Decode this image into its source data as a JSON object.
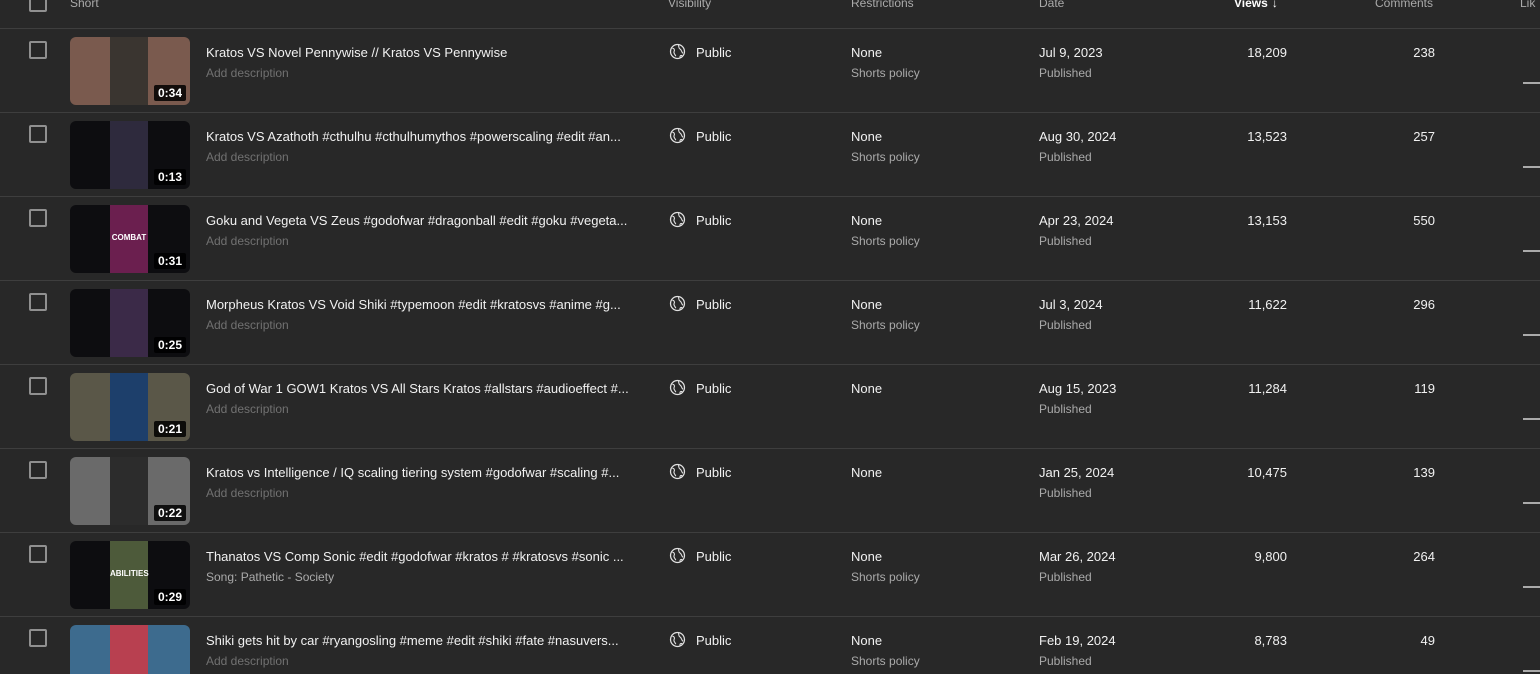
{
  "header": {
    "short": "Short",
    "visibility": "Visibility",
    "restrictions": "Restrictions",
    "date": "Date",
    "views": "Views",
    "views_sort_arrow": "↓",
    "comments": "Comments",
    "likes": "Lik"
  },
  "rows": [
    {
      "title": "Kratos VS Novel Pennywise // Kratos VS Pennywise",
      "description": "Add description",
      "duration": "0:34",
      "visibility": "Public",
      "restriction": "None",
      "restriction_detail": "Shorts policy",
      "date": "Jul 9, 2023",
      "status": "Published",
      "views": "18,209",
      "comments": "238",
      "thumb_bg": "#7a5a4e",
      "thumb_art": "#3a3530"
    },
    {
      "title": "Kratos VS Azathoth #cthulhu #cthulhumythos #powerscaling #edit #an...",
      "description": "Add description",
      "duration": "0:13",
      "visibility": "Public",
      "restriction": "None",
      "restriction_detail": "Shorts policy",
      "date": "Aug 30, 2024",
      "status": "Published",
      "views": "13,523",
      "comments": "257",
      "thumb_bg": "#0d0d10",
      "thumb_art": "#2e2a3d"
    },
    {
      "title": "Goku and Vegeta VS Zeus #godofwar #dragonball #edit #goku #vegeta...",
      "description": "Add description",
      "duration": "0:31",
      "visibility": "Public",
      "restriction": "None",
      "restriction_detail": "Shorts policy",
      "date": "Apr 23, 2024",
      "status": "Published",
      "views": "13,153",
      "comments": "550",
      "thumb_bg": "#0d0d10",
      "thumb_art": "#6b1f4f",
      "thumb_label": "COMBAT"
    },
    {
      "title": "Morpheus Kratos VS Void Shiki #typemoon #edit #kratosvs #anime #g...",
      "description": "Add description",
      "duration": "0:25",
      "visibility": "Public",
      "restriction": "None",
      "restriction_detail": "Shorts policy",
      "date": "Jul 3, 2024",
      "status": "Published",
      "views": "11,622",
      "comments": "296",
      "thumb_bg": "#0d0d10",
      "thumb_art": "#3b2a48"
    },
    {
      "title": "God of War 1 GOW1 Kratos VS All Stars Kratos #allstars #audioeffect #...",
      "description": "Add description",
      "duration": "0:21",
      "visibility": "Public",
      "restriction": "None",
      "restriction_detail": "",
      "date": "Aug 15, 2023",
      "status": "Published",
      "views": "11,284",
      "comments": "119",
      "thumb_bg": "#5a5748",
      "thumb_art": "#1d3f6b"
    },
    {
      "title": "Kratos vs Intelligence / IQ scaling tiering system #godofwar #scaling #...",
      "description": "Add description",
      "duration": "0:22",
      "visibility": "Public",
      "restriction": "None",
      "restriction_detail": "",
      "date": "Jan 25, 2024",
      "status": "Published",
      "views": "10,475",
      "comments": "139",
      "thumb_bg": "#6a6a6a",
      "thumb_art": "#2c2c2c"
    },
    {
      "title": "Thanatos VS Comp Sonic #edit #godofwar #kratos # #kratosvs #sonic ...",
      "description": "Song: Pathetic - Society",
      "duration": "0:29",
      "visibility": "Public",
      "restriction": "None",
      "restriction_detail": "Shorts policy",
      "date": "Mar 26, 2024",
      "status": "Published",
      "views": "9,800",
      "comments": "264",
      "thumb_bg": "#0d0d10",
      "thumb_art": "#4d5a3a",
      "thumb_label": "ABILITIES"
    },
    {
      "title": "Shiki gets hit by car #ryangosling #meme #edit #shiki #fate #nasuvers...",
      "description": "Add description",
      "duration": "",
      "visibility": "Public",
      "restriction": "None",
      "restriction_detail": "Shorts policy",
      "date": "Feb 19, 2024",
      "status": "Published",
      "views": "8,783",
      "comments": "49",
      "thumb_bg": "#3d6b8e",
      "thumb_art": "#b84050"
    }
  ]
}
